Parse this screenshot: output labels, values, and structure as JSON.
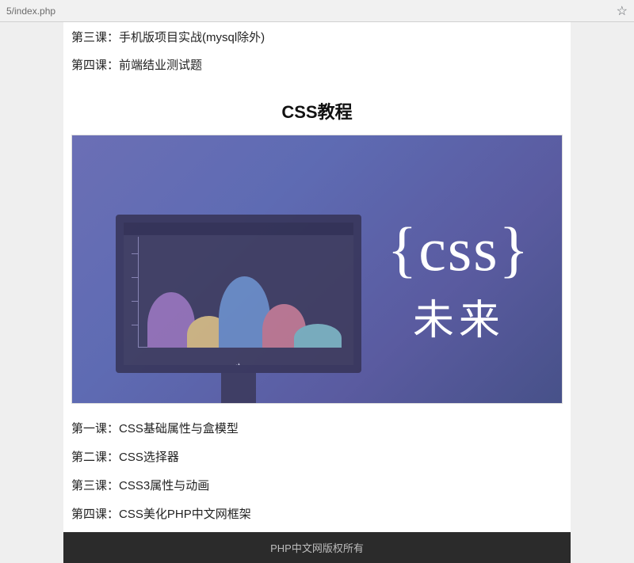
{
  "browser": {
    "url_fragment": "5/index.php"
  },
  "intro": {
    "items": [
      "第三课：手机版项目实战(mysql除外)",
      "第四课：前端结业测试题"
    ]
  },
  "section": {
    "title": "CSS教程"
  },
  "banner": {
    "brace_text": "{css}",
    "subtitle": "未来"
  },
  "lessons": [
    {
      "prefix": "第一课：",
      "title": "CSS基础属性与盒模型"
    },
    {
      "prefix": "第二课：",
      "title": "CSS选择器"
    },
    {
      "prefix": "第三课：",
      "title": "CSS3属性与动画"
    },
    {
      "prefix": "第四课：",
      "title": "CSS美化PHP中文网框架"
    }
  ],
  "footer": {
    "copyright": "PHP中文网版权所有"
  }
}
